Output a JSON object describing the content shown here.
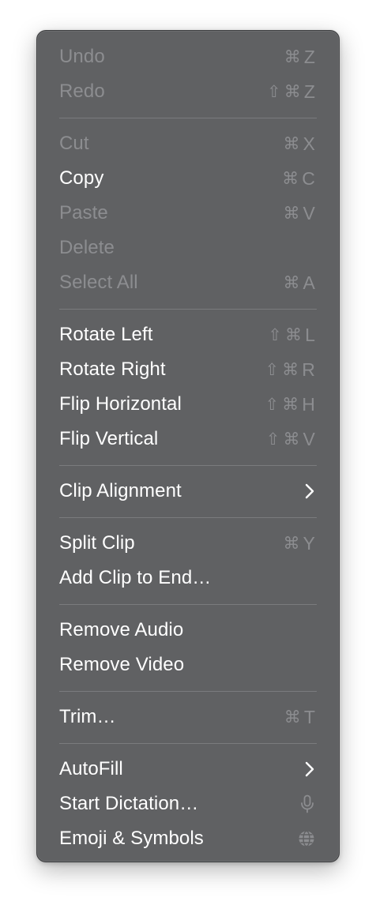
{
  "menu": {
    "undo": {
      "label": "Undo",
      "keys": [
        "⌘",
        "Z"
      ]
    },
    "redo": {
      "label": "Redo",
      "keys": [
        "⇧",
        "⌘",
        "Z"
      ]
    },
    "cut": {
      "label": "Cut",
      "keys": [
        "⌘",
        "X"
      ]
    },
    "copy": {
      "label": "Copy",
      "keys": [
        "⌘",
        "C"
      ]
    },
    "paste": {
      "label": "Paste",
      "keys": [
        "⌘",
        "V"
      ]
    },
    "delete": {
      "label": "Delete"
    },
    "select_all": {
      "label": "Select All",
      "keys": [
        "⌘",
        "A"
      ]
    },
    "rotate_left": {
      "label": "Rotate Left",
      "keys": [
        "⇧",
        "⌘",
        "L"
      ]
    },
    "rotate_right": {
      "label": "Rotate Right",
      "keys": [
        "⇧",
        "⌘",
        "R"
      ]
    },
    "flip_horizontal": {
      "label": "Flip Horizontal",
      "keys": [
        "⇧",
        "⌘",
        "H"
      ]
    },
    "flip_vertical": {
      "label": "Flip Vertical",
      "keys": [
        "⇧",
        "⌘",
        "V"
      ]
    },
    "clip_alignment": {
      "label": "Clip Alignment"
    },
    "split_clip": {
      "label": "Split Clip",
      "keys": [
        "⌘",
        "Y"
      ]
    },
    "add_clip_to_end": {
      "label": "Add Clip to End…"
    },
    "remove_audio": {
      "label": "Remove Audio"
    },
    "remove_video": {
      "label": "Remove Video"
    },
    "trim": {
      "label": "Trim…",
      "keys": [
        "⌘",
        "T"
      ]
    },
    "autofill": {
      "label": "AutoFill"
    },
    "start_dictation": {
      "label": "Start Dictation…"
    },
    "emoji_symbols": {
      "label": "Emoji & Symbols"
    }
  },
  "icons": {
    "submenu": "chevron-right-icon",
    "dictation": "microphone-icon",
    "emoji": "globe-icon"
  },
  "colors": {
    "menu_background": "#606163",
    "enabled_text": "#ffffff",
    "disabled_text": "#8c8d90",
    "separator": "#7a7b7e"
  }
}
